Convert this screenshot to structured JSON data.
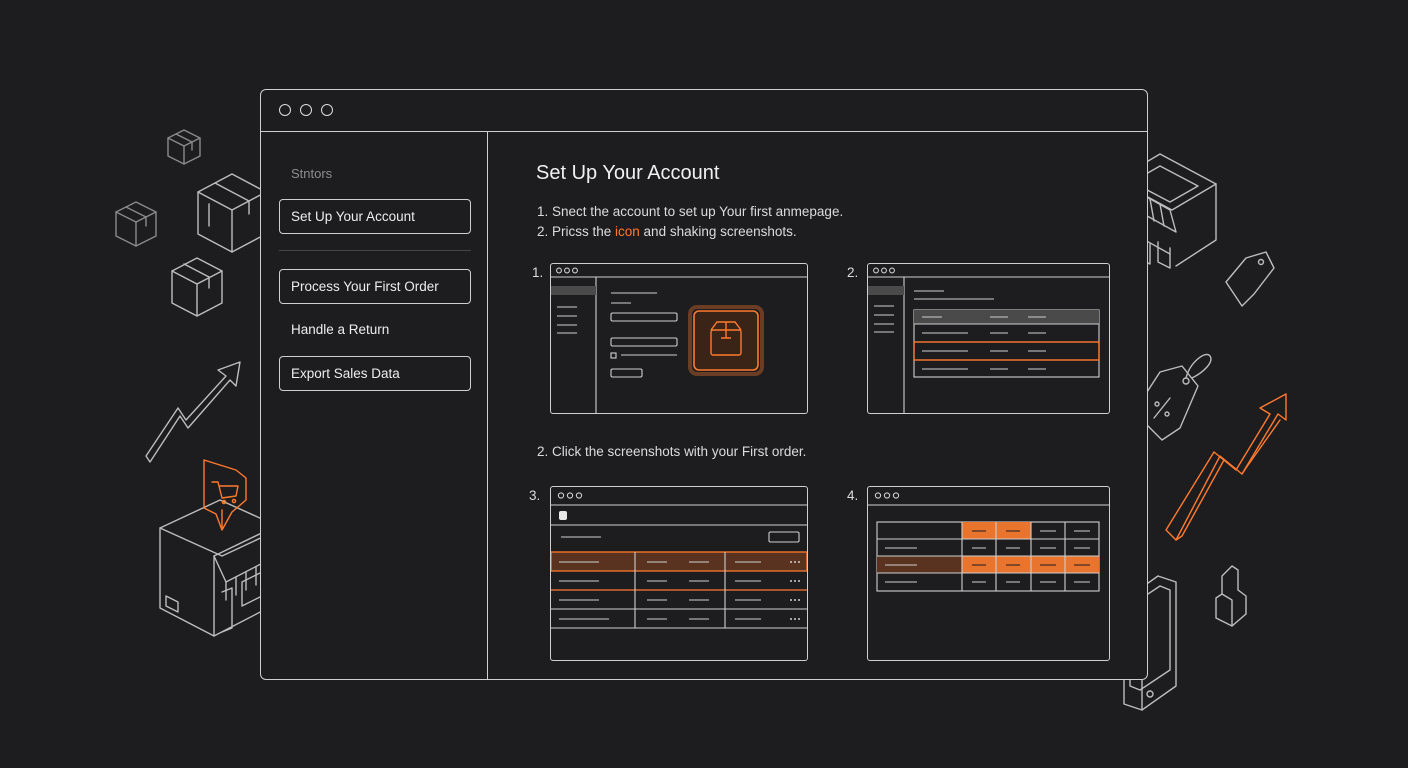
{
  "sidebar": {
    "heading": "Stntors",
    "items": [
      {
        "label": "Set Up Your Account"
      },
      {
        "label": "Process Your First Order"
      },
      {
        "label": "Handle a Return"
      },
      {
        "label": "Export Sales Data"
      }
    ]
  },
  "main": {
    "title": "Set Up Your Account",
    "steps": [
      {
        "text": "1. Snect the account to set up Your first anmepage."
      },
      {
        "prefix": "2. Pricss the ",
        "highlight": "icon",
        "suffix": " and shaking screenshots."
      }
    ],
    "section2": "2. Click the screenshots with your First order.",
    "screenshots": [
      {
        "number": "1."
      },
      {
        "number": "2."
      },
      {
        "number": "3."
      },
      {
        "number": "4."
      }
    ]
  },
  "icons": [
    "box-icon",
    "box-icon",
    "box-icon",
    "box-icon",
    "trend-arrow-icon",
    "storefront-icon",
    "cart-sign-icon",
    "storefront-icon",
    "price-tag-icon",
    "discount-tag-icon",
    "trend-arrow-icon",
    "smartphone-icon",
    "hand-cursor-icon"
  ],
  "colors": {
    "background": "#1d1d1f",
    "line": "#cfcfcf",
    "accent": "#ff7a2e"
  }
}
